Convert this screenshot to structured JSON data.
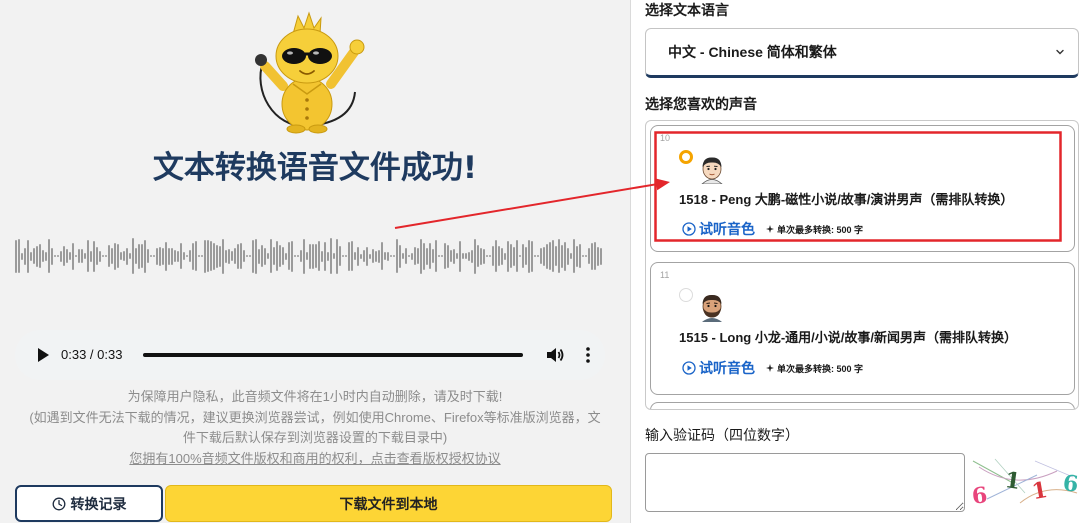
{
  "left": {
    "title": "文本转换语音文件成功!",
    "audio": {
      "time": "0:33 / 0:33",
      "progress_fraction": 1
    },
    "notice_line": "为保障用户隐私，此音频文件将在1小时内自动删除，请及时下载!",
    "notice_tip": "(如遇到文件无法下载的情况，建议更换浏览器尝试，例如使用Chrome、Firefox等标准版浏览器，文件下载后默认保存到浏览器设置的下载目录中)",
    "license_link": "您拥有100%音频文件版权和商用的权利，点击查看版权授权协议",
    "history_button": "转换记录",
    "download_button": "下载文件到本地"
  },
  "right": {
    "language_label": "选择文本语言",
    "language_selected": "中文 - Chinese 简体和繁体",
    "voice_label": "选择您喜欢的声音",
    "voices": [
      {
        "index": "10",
        "name": "1518 - Peng 大鹏-磁性小说/故事/演讲男声（需排队转换）",
        "selected": true,
        "preview_label": "试听音色",
        "limit": "单次最多转换: 500 字"
      },
      {
        "index": "11",
        "name": "1515 - Long 小龙-通用/小说/故事/新闻男声（需排队转换）",
        "selected": false,
        "preview_label": "试听音色",
        "limit": "单次最多转换: 500 字"
      }
    ],
    "captcha_label": "输入验证码（四位数字）",
    "captcha": {
      "digits": [
        {
          "char": "6",
          "color": "#e8457c"
        },
        {
          "char": "1",
          "color": "#2e5b32"
        },
        {
          "char": "1",
          "color": "#d9363e"
        },
        {
          "char": "6",
          "color": "#35b3a6"
        }
      ]
    }
  },
  "colors": {
    "primary_navy": "#1e3a5f",
    "download_yellow": "#fdd535",
    "link_blue": "#1a64c8",
    "radio_selected": "#f5a400",
    "annotation_red": "#e3262b"
  },
  "icons": {
    "mascot": "mascot-image",
    "play": "play-icon",
    "volume": "volume-icon",
    "more": "more-vertical-icon",
    "history": "clock-icon",
    "select": "chevron-down-icon",
    "preview": "play-circle-icon",
    "limit": "sparkle-icon"
  }
}
